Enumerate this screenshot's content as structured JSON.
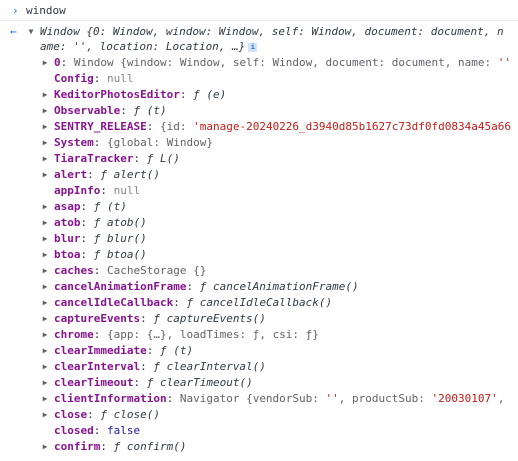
{
  "prompt": {
    "glyph": "›",
    "expression": "window"
  },
  "result": {
    "back_glyph": "←",
    "summary_prefix": "Window {0: Window, window: Window, self: Window, document: document, n",
    "summary_wrap": "ame: '', location: Location, …}",
    "info_glyph": "i"
  },
  "props": [
    {
      "caret": "▶",
      "name": "0",
      "name_dim": false,
      "sep": ": ",
      "value": "Window {window: Window, self: Window, document: document, name: ''"
    },
    {
      "caret": "",
      "name": "Config",
      "name_dim": false,
      "sep": ": ",
      "value": "null"
    },
    {
      "caret": "▶",
      "name": "KeditorPhotosEditor",
      "name_dim": false,
      "sep": ": ",
      "value": "ƒ (e)"
    },
    {
      "caret": "▶",
      "name": "Observable",
      "name_dim": false,
      "sep": ": ",
      "value": "ƒ (t)"
    },
    {
      "caret": "▶",
      "name": "SENTRY_RELEASE",
      "name_dim": false,
      "sep": ": ",
      "value": "{id: 'manage-20240226_d3940d85b1627c73df0fd0834a45a66"
    },
    {
      "caret": "▶",
      "name": "System",
      "name_dim": false,
      "sep": ": ",
      "value": "{global: Window}"
    },
    {
      "caret": "▶",
      "name": "TiaraTracker",
      "name_dim": false,
      "sep": ": ",
      "value": "ƒ L()"
    },
    {
      "caret": "▶",
      "name": "alert",
      "name_dim": false,
      "sep": ": ",
      "value": "ƒ alert()"
    },
    {
      "caret": "",
      "name": "appInfo",
      "name_dim": false,
      "sep": ": ",
      "value": "null"
    },
    {
      "caret": "▶",
      "name": "asap",
      "name_dim": false,
      "sep": ": ",
      "value": "ƒ (t)"
    },
    {
      "caret": "▶",
      "name": "atob",
      "name_dim": false,
      "sep": ": ",
      "value": "ƒ atob()"
    },
    {
      "caret": "▶",
      "name": "blur",
      "name_dim": false,
      "sep": ": ",
      "value": "ƒ blur()"
    },
    {
      "caret": "▶",
      "name": "btoa",
      "name_dim": false,
      "sep": ": ",
      "value": "ƒ btoa()"
    },
    {
      "caret": "▶",
      "name": "caches",
      "name_dim": false,
      "sep": ": ",
      "value": "CacheStorage {}"
    },
    {
      "caret": "▶",
      "name": "cancelAnimationFrame",
      "name_dim": false,
      "sep": ": ",
      "value": "ƒ cancelAnimationFrame()"
    },
    {
      "caret": "▶",
      "name": "cancelIdleCallback",
      "name_dim": false,
      "sep": ": ",
      "value": "ƒ cancelIdleCallback()"
    },
    {
      "caret": "▶",
      "name": "captureEvents",
      "name_dim": false,
      "sep": ": ",
      "value": "ƒ captureEvents()"
    },
    {
      "caret": "▶",
      "name": "chrome",
      "name_dim": false,
      "sep": ": ",
      "value": "{app: {…}, loadTimes: ƒ, csi: ƒ}"
    },
    {
      "caret": "▶",
      "name": "clearImmediate",
      "name_dim": false,
      "sep": ": ",
      "value": "ƒ (t)"
    },
    {
      "caret": "▶",
      "name": "clearInterval",
      "name_dim": false,
      "sep": ": ",
      "value": "ƒ clearInterval()"
    },
    {
      "caret": "▶",
      "name": "clearTimeout",
      "name_dim": false,
      "sep": ": ",
      "value": "ƒ clearTimeout()"
    },
    {
      "caret": "▶",
      "name": "clientInformation",
      "name_dim": false,
      "sep": ": ",
      "value": "Navigator {vendorSub: '', productSub: '20030107',"
    },
    {
      "caret": "▶",
      "name": "close",
      "name_dim": false,
      "sep": ": ",
      "value": "ƒ close()"
    },
    {
      "caret": "",
      "name": "closed",
      "name_dim": false,
      "sep": ": ",
      "value": "false"
    },
    {
      "caret": "▶",
      "name": "confirm",
      "name_dim": false,
      "sep": ": ",
      "value": "ƒ confirm()"
    }
  ]
}
